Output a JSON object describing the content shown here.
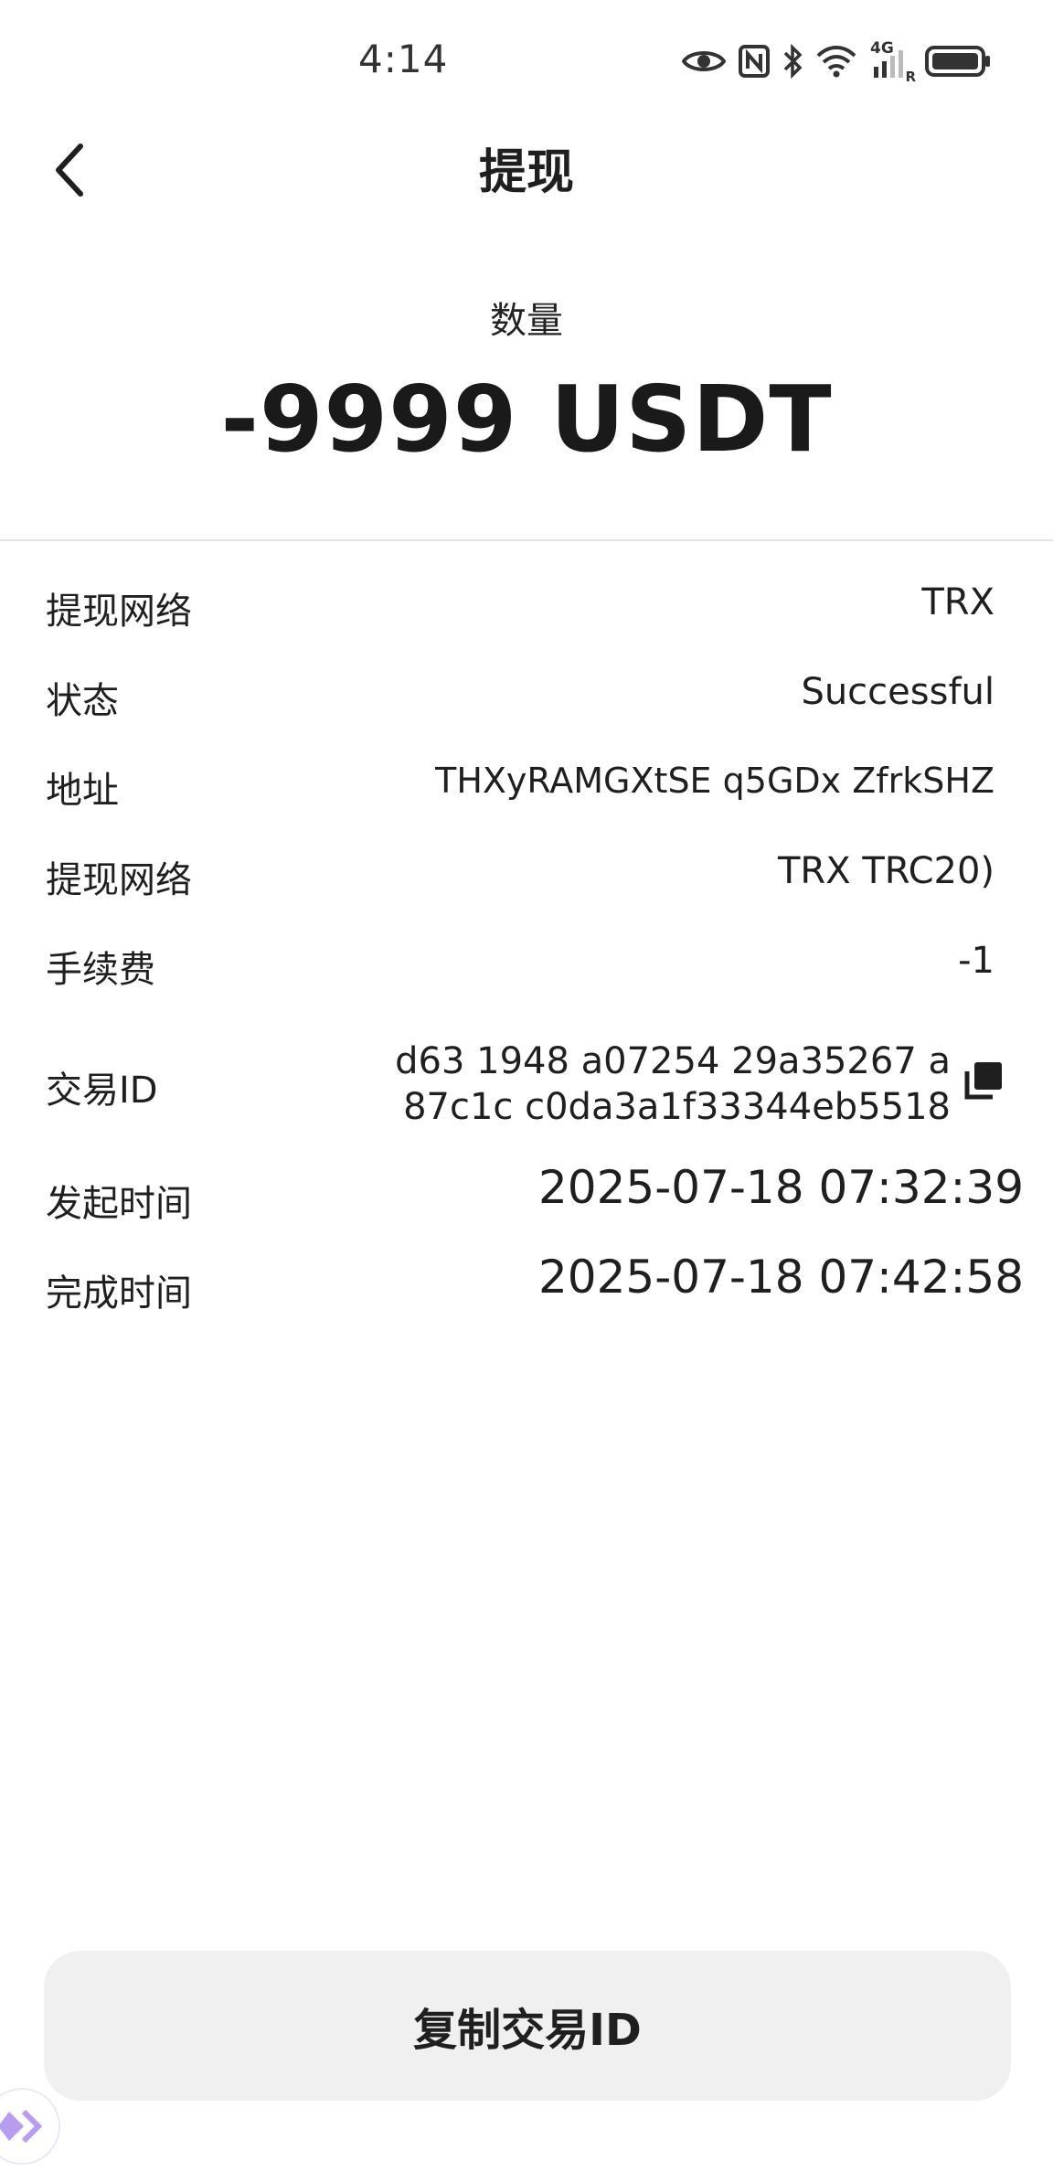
{
  "status_bar": {
    "time": "4:14",
    "network_label": "4G",
    "roaming_label": "R"
  },
  "header": {
    "title": "提现",
    "back_icon": "chevron-left-icon"
  },
  "amount": {
    "label": "数量",
    "value": "-9999 USDT"
  },
  "details": {
    "network": {
      "label": "提现网络",
      "value": "TRX"
    },
    "status": {
      "label": "状态",
      "value": "Successful"
    },
    "address": {
      "label": "地址",
      "value": "THXyRAMGXtSE        q5GDx        ZfrkSHZ"
    },
    "network2": {
      "label": "提现网络",
      "value": "TRX          TRC20)"
    },
    "fee": {
      "label": "手续费",
      "value": "-1"
    },
    "txid": {
      "label": "交易ID",
      "value": "d63    1948       a07254      29a35267 a      87c1c       c0da3a1f33344eb5518"
    },
    "start_time": {
      "label": "发起时间",
      "value": "2025-07-18  07:32:39"
    },
    "complete_time": {
      "label": "完成时间",
      "value": "2025-07-18  07:42:58"
    }
  },
  "actions": {
    "copy_button": "复制交易ID"
  },
  "colors": {
    "text": "#1a1a1a",
    "button_bg": "#f0f0f0",
    "divider": "#e4e4e4",
    "accent": "#9b7fe8"
  }
}
